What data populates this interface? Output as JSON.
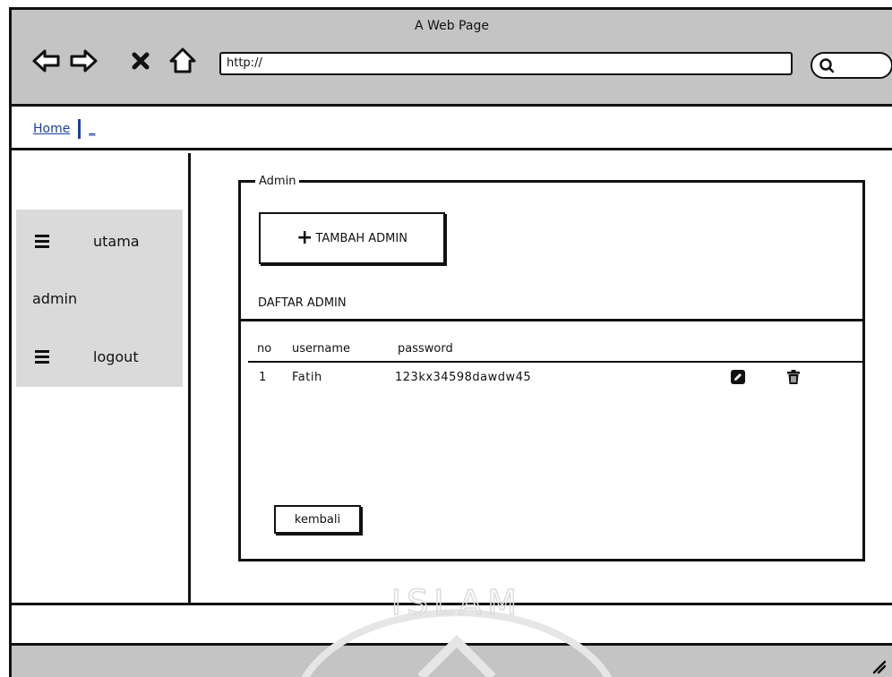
{
  "window": {
    "title": "A Web Page"
  },
  "browser": {
    "back_icon": "back-arrow-icon",
    "forward_icon": "forward-arrow-icon",
    "stop_icon": "close-icon",
    "home_icon": "home-icon",
    "url": "http://",
    "search_icon": "search-icon"
  },
  "breadcrumb": {
    "home": "Home",
    "more": "_"
  },
  "sidebar": {
    "items": [
      {
        "label": "utama",
        "icon": "menu-icon"
      },
      {
        "label": "admin"
      },
      {
        "label": "logout",
        "icon": "menu-icon"
      }
    ]
  },
  "admin_panel": {
    "legend": "Admin",
    "add_button": "TAMBAH ADMIN",
    "list_title": "DAFTAR ADMIN",
    "columns": [
      "no",
      "username",
      "password"
    ],
    "rows": [
      {
        "no": "1",
        "username": "Fatih",
        "password": "123kx34598dawdw45",
        "edit_icon": "edit-icon",
        "delete_icon": "trash-icon"
      }
    ],
    "back_button": "kembali"
  },
  "watermark": {
    "text": "ISLAM"
  },
  "colors": {
    "toolbar_bg": "#c4c4c4",
    "sidebar_bg": "#dadada",
    "link": "#1a3fa8"
  }
}
